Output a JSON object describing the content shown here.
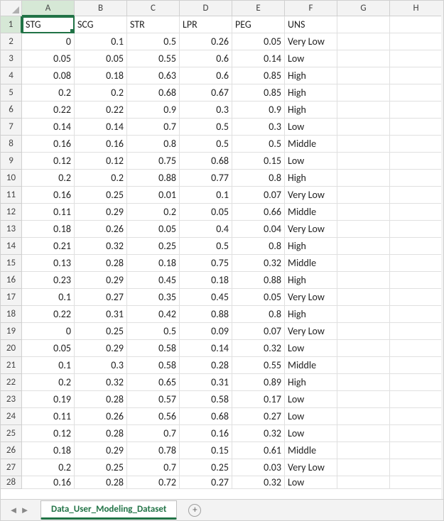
{
  "columns": [
    "A",
    "B",
    "C",
    "D",
    "E",
    "F",
    "G",
    "H"
  ],
  "active_cell": {
    "row": 1,
    "col": 0
  },
  "chart_data": {
    "type": "table",
    "headers": [
      "STG",
      "SCG",
      "STR",
      "LPR",
      "PEG",
      "UNS"
    ],
    "rows": [
      [
        "0",
        "0.1",
        "0.5",
        "0.26",
        "0.05",
        "Very Low"
      ],
      [
        "0.05",
        "0.05",
        "0.55",
        "0.6",
        "0.14",
        "Low"
      ],
      [
        "0.08",
        "0.18",
        "0.63",
        "0.6",
        "0.85",
        "High"
      ],
      [
        "0.2",
        "0.2",
        "0.68",
        "0.67",
        "0.85",
        "High"
      ],
      [
        "0.22",
        "0.22",
        "0.9",
        "0.3",
        "0.9",
        "High"
      ],
      [
        "0.14",
        "0.14",
        "0.7",
        "0.5",
        "0.3",
        "Low"
      ],
      [
        "0.16",
        "0.16",
        "0.8",
        "0.5",
        "0.5",
        "Middle"
      ],
      [
        "0.12",
        "0.12",
        "0.75",
        "0.68",
        "0.15",
        "Low"
      ],
      [
        "0.2",
        "0.2",
        "0.88",
        "0.77",
        "0.8",
        "High"
      ],
      [
        "0.16",
        "0.25",
        "0.01",
        "0.1",
        "0.07",
        "Very Low"
      ],
      [
        "0.11",
        "0.29",
        "0.2",
        "0.05",
        "0.66",
        "Middle"
      ],
      [
        "0.18",
        "0.26",
        "0.05",
        "0.4",
        "0.04",
        "Very Low"
      ],
      [
        "0.21",
        "0.32",
        "0.25",
        "0.5",
        "0.8",
        "High"
      ],
      [
        "0.13",
        "0.28",
        "0.18",
        "0.75",
        "0.32",
        "Middle"
      ],
      [
        "0.23",
        "0.29",
        "0.45",
        "0.18",
        "0.88",
        "High"
      ],
      [
        "0.1",
        "0.27",
        "0.35",
        "0.45",
        "0.05",
        "Very Low"
      ],
      [
        "0.22",
        "0.31",
        "0.42",
        "0.88",
        "0.8",
        "High"
      ],
      [
        "0",
        "0.25",
        "0.5",
        "0.09",
        "0.07",
        "Very Low"
      ],
      [
        "0.05",
        "0.29",
        "0.58",
        "0.14",
        "0.32",
        "Low"
      ],
      [
        "0.1",
        "0.3",
        "0.58",
        "0.28",
        "0.55",
        "Middle"
      ],
      [
        "0.2",
        "0.32",
        "0.65",
        "0.31",
        "0.89",
        "High"
      ],
      [
        "0.19",
        "0.28",
        "0.57",
        "0.58",
        "0.17",
        "Low"
      ],
      [
        "0.11",
        "0.26",
        "0.56",
        "0.68",
        "0.27",
        "Low"
      ],
      [
        "0.12",
        "0.28",
        "0.7",
        "0.16",
        "0.32",
        "Low"
      ],
      [
        "0.18",
        "0.29",
        "0.78",
        "0.15",
        "0.61",
        "Middle"
      ],
      [
        "0.2",
        "0.25",
        "0.7",
        "0.25",
        "0.03",
        "Very Low"
      ],
      [
        "0.16",
        "0.28",
        "0.72",
        "0.27",
        "0.32",
        "Low"
      ]
    ]
  },
  "sheet_tab": "Data_User_Modeling_Dataset",
  "nav": {
    "prev": "◄",
    "next": "►",
    "add": "+"
  }
}
